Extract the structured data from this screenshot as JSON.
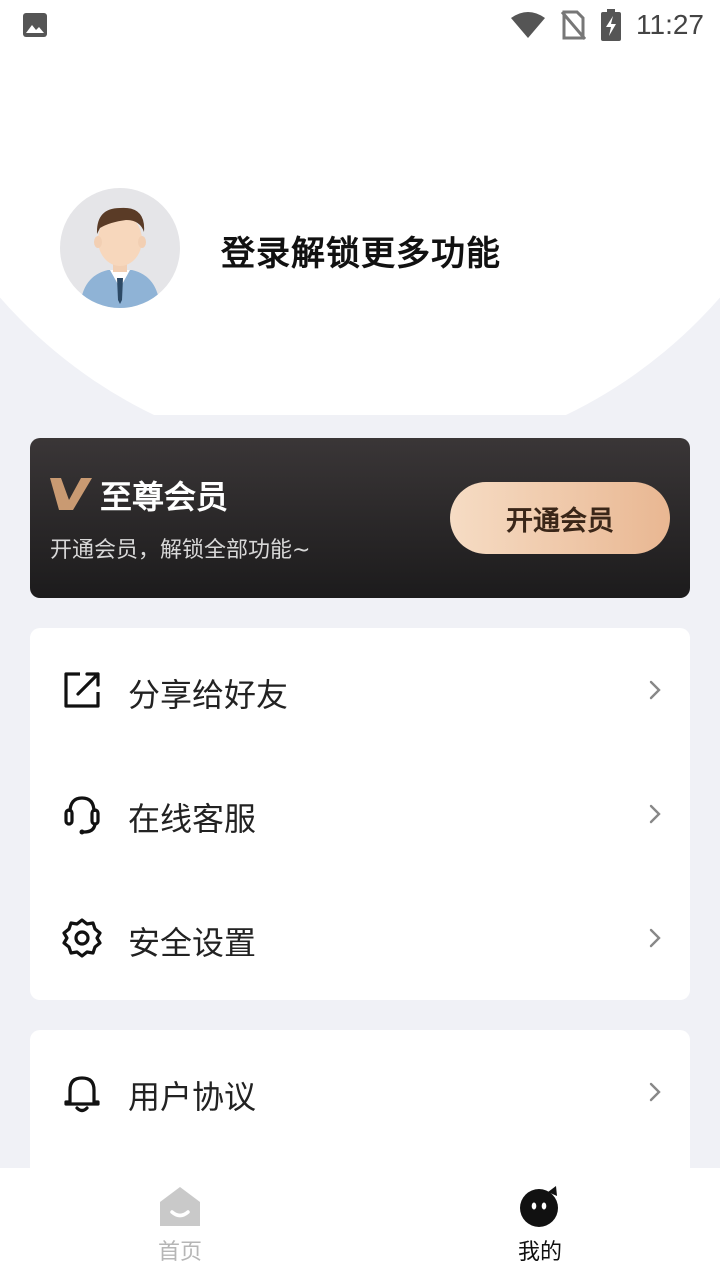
{
  "status_bar": {
    "time": "11:27"
  },
  "profile": {
    "login_prompt": "登录解锁更多功能"
  },
  "vip_card": {
    "title": "至尊会员",
    "subtitle": "开通会员，解锁全部功能~",
    "button_label": "开通会员",
    "colors": {
      "button_start": "#f6dcc4",
      "button_end": "#e9b792",
      "logo": "#c99a72"
    }
  },
  "menu_group_1": [
    {
      "label": "分享给好友",
      "icon": "share-icon"
    },
    {
      "label": "在线客服",
      "icon": "headset-icon"
    },
    {
      "label": "安全设置",
      "icon": "gear-icon"
    }
  ],
  "menu_group_2": [
    {
      "label": "用户协议",
      "icon": "bell-icon"
    }
  ],
  "tab_bar": {
    "tabs": [
      {
        "label": "首页",
        "icon": "home-icon",
        "active": false
      },
      {
        "label": "我的",
        "icon": "mine-icon",
        "active": true
      }
    ]
  }
}
